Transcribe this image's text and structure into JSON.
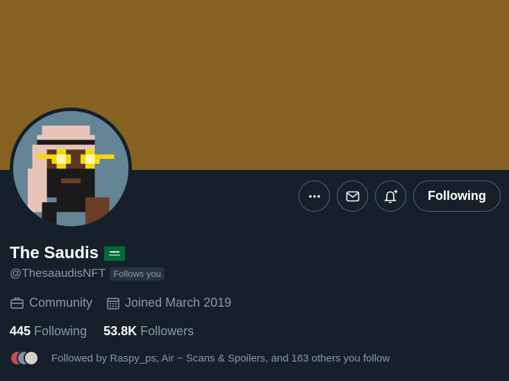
{
  "profile": {
    "display_name": "The Saudis",
    "handle": "@ThesaaudisNFT",
    "follows_you": "Follows you",
    "category": "Community",
    "joined": "Joined March 2019",
    "following_count": "445",
    "following_label": "Following",
    "followers_count": "53.8K",
    "followers_label": "Followers",
    "followed_by": "Followed by Raspy_ps, Air ~ Scans & Spoilers, and 163 others you follow"
  },
  "actions": {
    "more_icon": "more-horizontal-icon",
    "message_icon": "envelope-icon",
    "notify_icon": "bell-plus-icon",
    "follow_label": "Following"
  },
  "colors": {
    "banner": "#876223",
    "background": "#15202b",
    "secondary_text": "#8b98a5",
    "flag_green": "#006c35"
  }
}
